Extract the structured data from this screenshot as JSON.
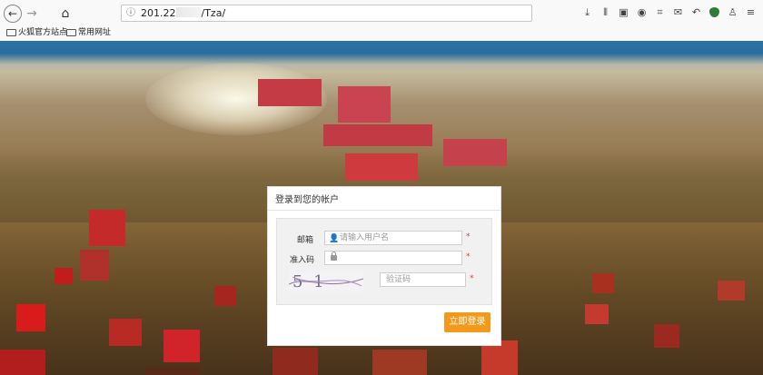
{
  "browser": {
    "url_prefix": "201.22",
    "url_suffix": "/Tza/",
    "bookmarks": [
      {
        "label": "火狐官方站点"
      },
      {
        "label": "常用网址"
      }
    ],
    "toolbar_icons": [
      "download-icon",
      "library-icon",
      "reader-icon",
      "account-icon",
      "screenshot-icon",
      "chat-icon",
      "undo-icon",
      "shield-icon",
      "extension-icon",
      "menu-icon"
    ]
  },
  "login": {
    "title": "登录到您的帐户",
    "email_label": "邮箱",
    "email_placeholder": "请输入用户名",
    "password_label": "准入码",
    "captcha_text": "5 1 W4",
    "captcha_placeholder": "验证码",
    "required_mark": "*",
    "submit_label": "立即登录",
    "submit_color": "#f39a1c"
  }
}
